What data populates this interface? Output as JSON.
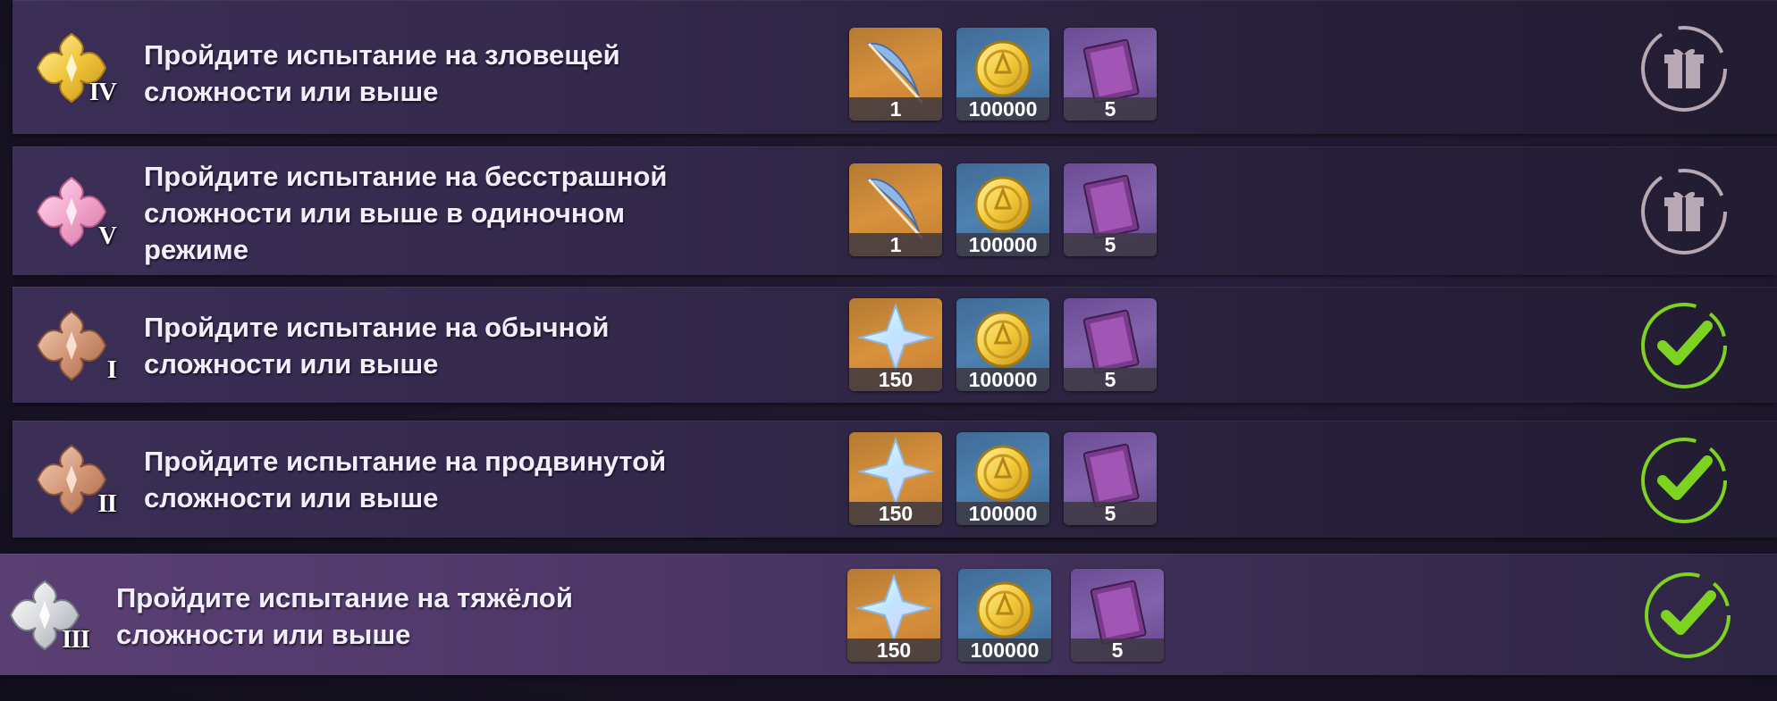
{
  "colors": {
    "check_green": "#7ed321",
    "gift_dim": "#b8a8b4",
    "row_bg": "#35294d",
    "row_bg_highlight": "#4e3868"
  },
  "challenges": [
    {
      "rank": "IV",
      "badge": "gold-flower-badge",
      "text_line1": "Пройдите испытание на зловещей",
      "text_line2": "сложности или выше",
      "text_line3": "",
      "rewards": [
        {
          "icon": "feather-icon",
          "count": "1"
        },
        {
          "icon": "mora-coin-icon",
          "count": "100000"
        },
        {
          "icon": "book-icon",
          "count": "5"
        }
      ],
      "status": "gift-claimed-icon"
    },
    {
      "rank": "V",
      "badge": "pink-flower-badge",
      "text_line1": "Пройдите испытание на бесстрашной",
      "text_line2": "сложности или выше в одиночном",
      "text_line3": "режиме",
      "rewards": [
        {
          "icon": "feather-icon",
          "count": "1"
        },
        {
          "icon": "mora-coin-icon",
          "count": "100000"
        },
        {
          "icon": "book-icon",
          "count": "5"
        }
      ],
      "status": "gift-claimed-icon"
    },
    {
      "rank": "I",
      "badge": "bronze-flower-badge",
      "text_line1": "Пройдите испытание на обычной",
      "text_line2": "сложности или выше",
      "text_line3": "",
      "rewards": [
        {
          "icon": "primogem-icon",
          "count": "150"
        },
        {
          "icon": "mora-coin-icon",
          "count": "100000"
        },
        {
          "icon": "book-icon",
          "count": "5"
        }
      ],
      "status": "completed-check-icon"
    },
    {
      "rank": "II",
      "badge": "bronze-flower-badge",
      "text_line1": "Пройдите испытание на продвинутой",
      "text_line2": "сложности или выше",
      "text_line3": "",
      "rewards": [
        {
          "icon": "primogem-icon",
          "count": "150"
        },
        {
          "icon": "mora-coin-icon",
          "count": "100000"
        },
        {
          "icon": "book-icon",
          "count": "5"
        }
      ],
      "status": "completed-check-icon"
    },
    {
      "rank": "III",
      "badge": "silver-flower-badge",
      "text_line1": "Пройдите испытание на тяжёлой",
      "text_line2": "сложности или выше",
      "text_line3": "",
      "rewards": [
        {
          "icon": "primogem-icon",
          "count": "150"
        },
        {
          "icon": "mora-coin-icon",
          "count": "100000"
        },
        {
          "icon": "book-icon",
          "count": "5"
        }
      ],
      "status": "completed-check-icon"
    }
  ]
}
